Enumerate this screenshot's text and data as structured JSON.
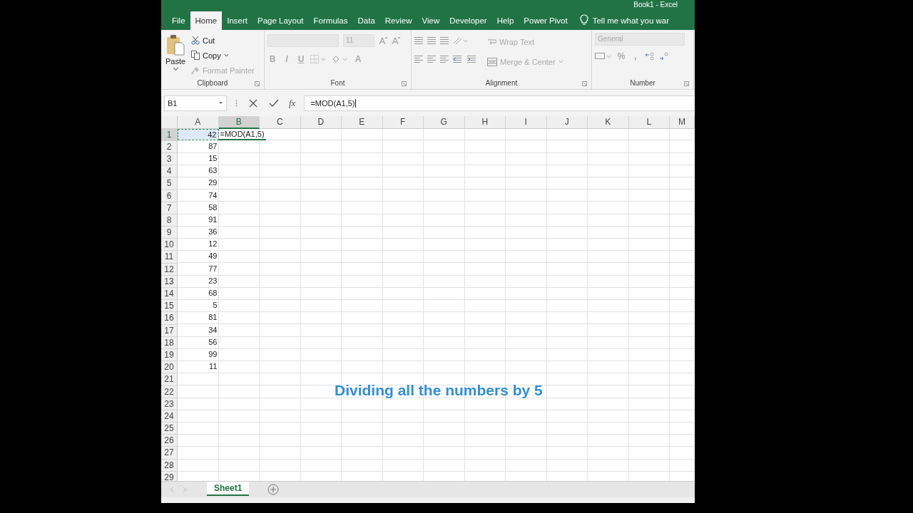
{
  "window": {
    "title": "Book1 - Excel"
  },
  "ribbon_tabs": [
    {
      "label": "File",
      "selected": false
    },
    {
      "label": "Home",
      "selected": true
    },
    {
      "label": "Insert",
      "selected": false
    },
    {
      "label": "Page Layout",
      "selected": false
    },
    {
      "label": "Formulas",
      "selected": false
    },
    {
      "label": "Data",
      "selected": false
    },
    {
      "label": "Review",
      "selected": false
    },
    {
      "label": "View",
      "selected": false
    },
    {
      "label": "Developer",
      "selected": false
    },
    {
      "label": "Help",
      "selected": false
    },
    {
      "label": "Power Pivot",
      "selected": false
    }
  ],
  "tell_me": "Tell me what you war",
  "clipboard": {
    "label": "Clipboard",
    "paste": "Paste",
    "cut": "Cut",
    "copy": "Copy",
    "format_painter": "Format Painter",
    "format_painter_disabled": true
  },
  "font": {
    "label": "Font",
    "size": "11",
    "disabled": true,
    "buttons": [
      "B",
      "I",
      "U"
    ],
    "font_color": "A"
  },
  "alignment": {
    "label": "Alignment",
    "disabled": true,
    "wrap_text": "Wrap Text",
    "merge_center": "Merge & Center"
  },
  "number": {
    "label": "Number",
    "disabled": true,
    "format": "General",
    "percent": "%",
    "comma": ","
  },
  "formula_bar": {
    "name_box": "B1",
    "fx": "fx",
    "formula": "=MOD(A1,5)"
  },
  "columns": [
    {
      "label": "A",
      "selected": false
    },
    {
      "label": "B",
      "selected": true
    },
    {
      "label": "C",
      "selected": false
    },
    {
      "label": "D",
      "selected": false
    },
    {
      "label": "E",
      "selected": false
    },
    {
      "label": "F",
      "selected": false
    },
    {
      "label": "G",
      "selected": false
    },
    {
      "label": "H",
      "selected": false
    },
    {
      "label": "I",
      "selected": false
    },
    {
      "label": "J",
      "selected": false
    },
    {
      "label": "K",
      "selected": false
    },
    {
      "label": "L",
      "selected": false
    },
    {
      "label": "M",
      "selected": false
    }
  ],
  "rows": [
    {
      "number": "1",
      "selected": true,
      "cells": [
        {
          "value": "42",
          "referenced": true
        },
        {
          "value": "=MOD(A1,5)",
          "editing": true
        }
      ]
    },
    {
      "number": "2",
      "selected": false,
      "cells": [
        {
          "value": "87"
        }
      ]
    },
    {
      "number": "3",
      "selected": false,
      "cells": [
        {
          "value": "15"
        }
      ]
    },
    {
      "number": "4",
      "selected": false,
      "cells": [
        {
          "value": "63"
        }
      ]
    },
    {
      "number": "5",
      "selected": false,
      "cells": [
        {
          "value": "29"
        }
      ]
    },
    {
      "number": "6",
      "selected": false,
      "cells": [
        {
          "value": "74"
        }
      ]
    },
    {
      "number": "7",
      "selected": false,
      "cells": [
        {
          "value": "58"
        }
      ]
    },
    {
      "number": "8",
      "selected": false,
      "cells": [
        {
          "value": "91"
        }
      ]
    },
    {
      "number": "9",
      "selected": false,
      "cells": [
        {
          "value": "36"
        }
      ]
    },
    {
      "number": "10",
      "selected": false,
      "cells": [
        {
          "value": "12"
        }
      ]
    },
    {
      "number": "11",
      "selected": false,
      "cells": [
        {
          "value": "49"
        }
      ]
    },
    {
      "number": "12",
      "selected": false,
      "cells": [
        {
          "value": "77"
        }
      ]
    },
    {
      "number": "13",
      "selected": false,
      "cells": [
        {
          "value": "23"
        }
      ]
    },
    {
      "number": "14",
      "selected": false,
      "cells": [
        {
          "value": "68"
        }
      ]
    },
    {
      "number": "15",
      "selected": false,
      "cells": [
        {
          "value": "5"
        }
      ]
    },
    {
      "number": "16",
      "selected": false,
      "cells": [
        {
          "value": "81"
        }
      ]
    },
    {
      "number": "17",
      "selected": false,
      "cells": [
        {
          "value": "34"
        }
      ]
    },
    {
      "number": "18",
      "selected": false,
      "cells": [
        {
          "value": "56"
        }
      ]
    },
    {
      "number": "19",
      "selected": false,
      "cells": [
        {
          "value": "99"
        }
      ]
    },
    {
      "number": "20",
      "selected": false,
      "cells": [
        {
          "value": "11"
        }
      ]
    },
    {
      "number": "21",
      "selected": false
    },
    {
      "number": "22",
      "selected": false
    },
    {
      "number": "23",
      "selected": false
    },
    {
      "number": "24",
      "selected": false
    },
    {
      "number": "25",
      "selected": false
    },
    {
      "number": "26",
      "selected": false
    },
    {
      "number": "27",
      "selected": false
    },
    {
      "number": "28",
      "selected": false
    },
    {
      "number": "29",
      "selected": false
    }
  ],
  "sheet_tabs": [
    {
      "label": "Sheet1",
      "selected": true
    }
  ],
  "caption": "Dividing all the numbers by 5"
}
